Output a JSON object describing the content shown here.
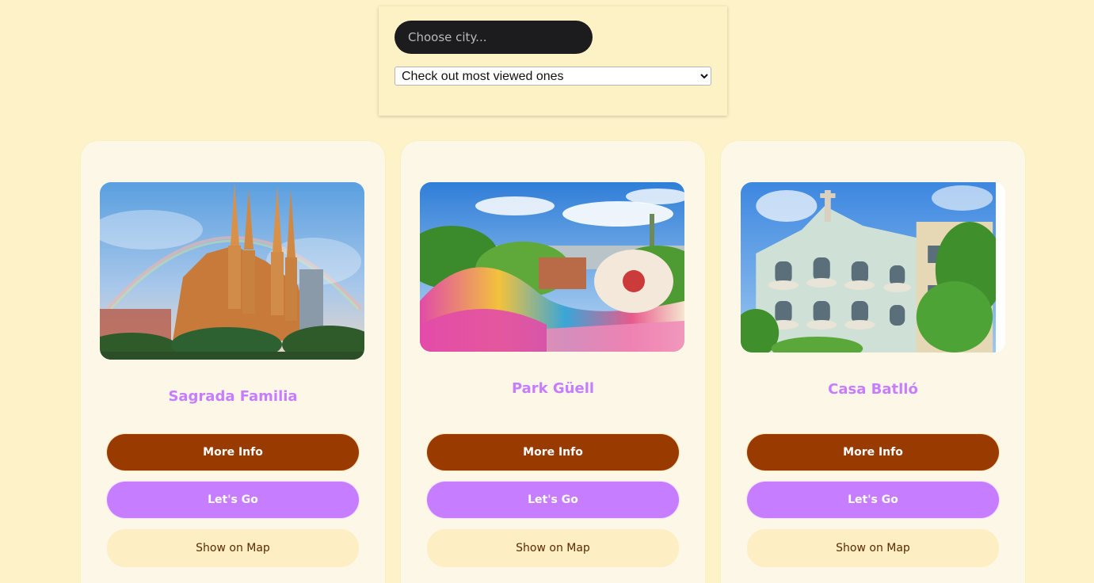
{
  "search": {
    "city_placeholder": "Choose city...",
    "select_selected": "Check out most viewed ones"
  },
  "cards": [
    {
      "title": "Sagrada Familia",
      "more_info": "More Info",
      "lets_go": "Let's Go",
      "show_on_map": "Show on Map"
    },
    {
      "title": "Park Güell",
      "more_info": "More Info",
      "lets_go": "Let's Go",
      "show_on_map": "Show on Map"
    },
    {
      "title": "Casa Batlló",
      "more_info": "More Info",
      "lets_go": "Let's Go",
      "show_on_map": "Show on Map"
    }
  ],
  "colors": {
    "page_bg": "#fef3c8",
    "card_bg": "#fcf7e6",
    "title_purple": "#c77dff",
    "more_info_brown": "#993a00",
    "lets_go_purple": "#c77dff",
    "map_button_bg": "#fdeec3"
  }
}
